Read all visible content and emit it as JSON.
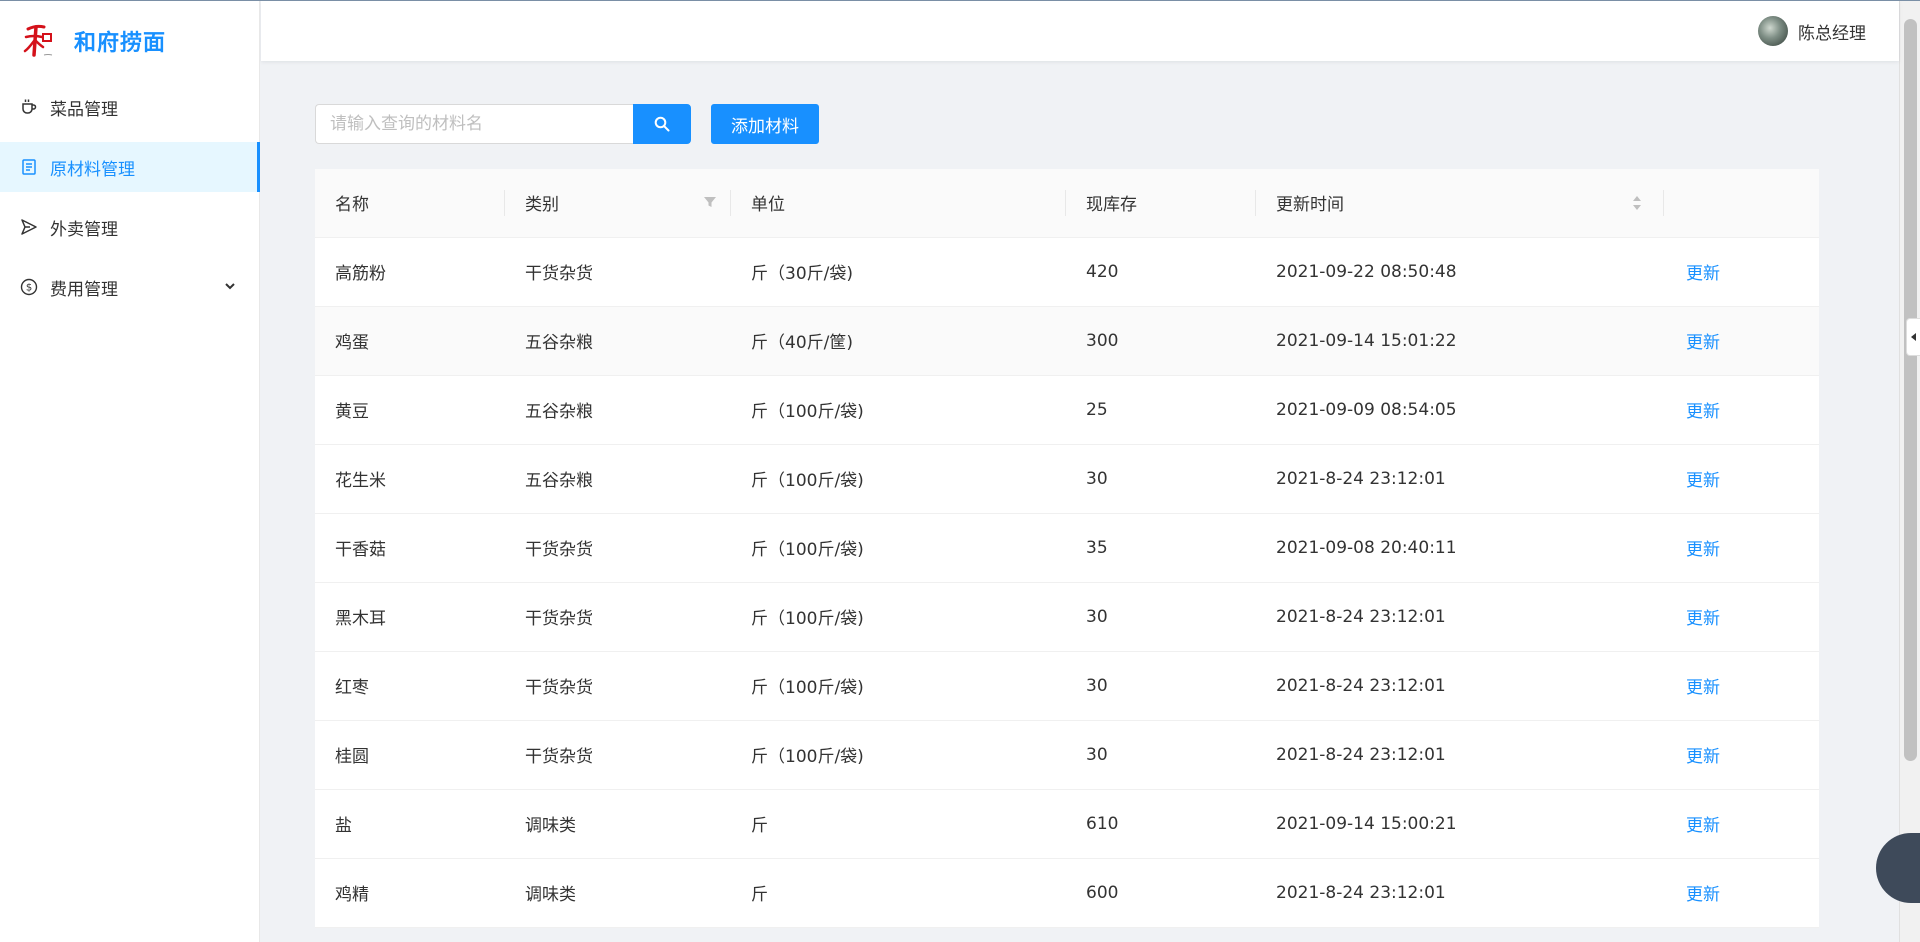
{
  "app": {
    "title": "和府捞面"
  },
  "sidebar": {
    "items": [
      {
        "label": "菜品管理",
        "icon": "cup-icon"
      },
      {
        "label": "原材料管理",
        "icon": "book-icon"
      },
      {
        "label": "外卖管理",
        "icon": "send-icon"
      },
      {
        "label": "费用管理",
        "icon": "dollar-icon"
      }
    ]
  },
  "header": {
    "user_name": "陈总经理"
  },
  "search": {
    "placeholder": "请输入查询的材料名",
    "value": ""
  },
  "toolbar": {
    "add_label": "添加材料"
  },
  "table": {
    "columns": [
      "名称",
      "类别",
      "单位",
      "现库存",
      "更新时间",
      ""
    ],
    "action_label": "更新",
    "rows": [
      {
        "name": "高筋粉",
        "category": "干货杂货",
        "unit": "斤（30斤/袋)",
        "stock": "420",
        "updated": "2021-09-22 08:50:48"
      },
      {
        "name": "鸡蛋",
        "category": "五谷杂粮",
        "unit": "斤（40斤/筐)",
        "stock": "300",
        "updated": "2021-09-14 15:01:22"
      },
      {
        "name": "黄豆",
        "category": "五谷杂粮",
        "unit": "斤（100斤/袋)",
        "stock": "25",
        "updated": "2021-09-09 08:54:05"
      },
      {
        "name": "花生米",
        "category": "五谷杂粮",
        "unit": "斤（100斤/袋)",
        "stock": "30",
        "updated": "2021-8-24 23:12:01"
      },
      {
        "name": "干香菇",
        "category": "干货杂货",
        "unit": "斤（100斤/袋)",
        "stock": "35",
        "updated": "2021-09-08 20:40:11"
      },
      {
        "name": "黑木耳",
        "category": "干货杂货",
        "unit": "斤（100斤/袋)",
        "stock": "30",
        "updated": "2021-8-24 23:12:01"
      },
      {
        "name": "红枣",
        "category": "干货杂货",
        "unit": "斤（100斤/袋)",
        "stock": "30",
        "updated": "2021-8-24 23:12:01"
      },
      {
        "name": "桂圆",
        "category": "干货杂货",
        "unit": "斤（100斤/袋)",
        "stock": "30",
        "updated": "2021-8-24 23:12:01"
      },
      {
        "name": "盐",
        "category": "调味类",
        "unit": "斤",
        "stock": "610",
        "updated": "2021-09-14 15:00:21"
      },
      {
        "name": "鸡精",
        "category": "调味类",
        "unit": "斤",
        "stock": "600",
        "updated": "2021-8-24 23:12:01"
      }
    ]
  },
  "colors": {
    "accent": "#1890ff",
    "sidebar_active_bg": "#e6f7ff",
    "page_bg": "#f0f2f5"
  }
}
